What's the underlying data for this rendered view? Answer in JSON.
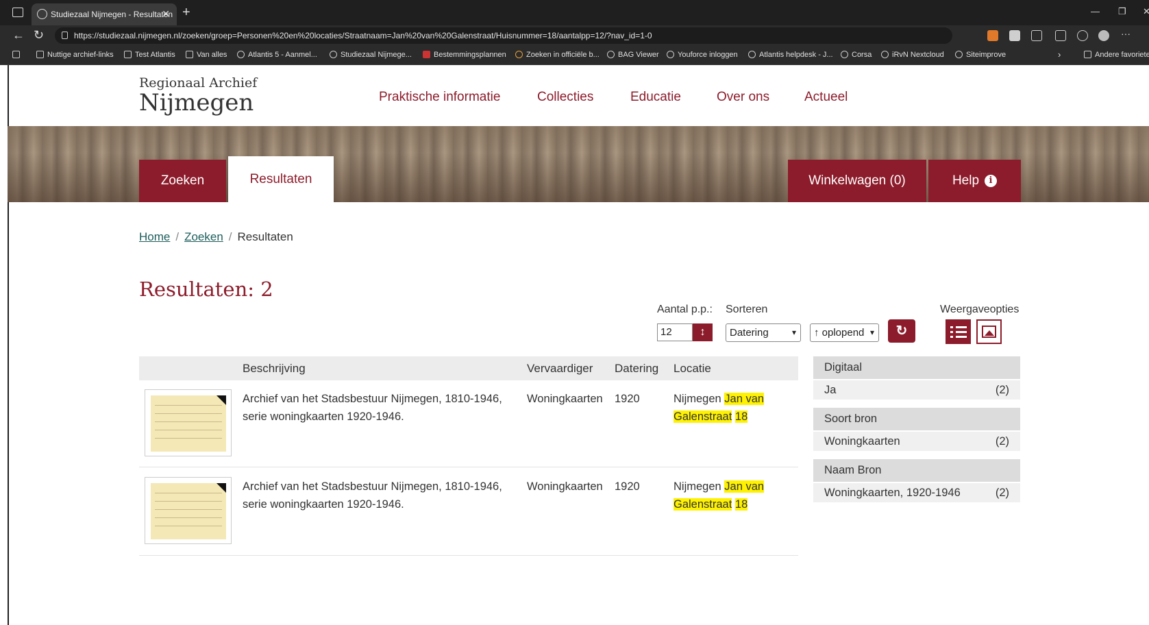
{
  "browser": {
    "tab_title": "Studiezaal Nijmegen - Resultaten",
    "url": "https://studiezaal.nijmegen.nl/zoeken/groep=Personen%20en%20locaties/Straatnaam=Jan%20van%20Galenstraat/Huisnummer=18/aantalpp=12/?nav_id=1-0",
    "bookmarks": [
      "Nuttige archief-links",
      "Test Atlantis",
      "Van alles",
      "Atlantis 5 - Aanmel...",
      "Studiezaal Nijmege...",
      "Bestemmingsplannen",
      "Zoeken in officiële b...",
      "BAG Viewer",
      "Youforce inloggen",
      "Atlantis helpdesk - J...",
      "Corsa",
      "iRvN Nextcloud",
      "Siteimprove"
    ],
    "other_favorites": "Andere favoriete"
  },
  "site": {
    "logo_small": "Regionaal Archief",
    "logo_big": "Nijmegen",
    "nav": [
      "Praktische informatie",
      "Collecties",
      "Educatie",
      "Over ons",
      "Actueel"
    ],
    "tab_zoeken": "Zoeken",
    "tab_resultaten": "Resultaten",
    "winkelwagen": "Winkelwagen (0)",
    "help": "Help",
    "help_icon": "i"
  },
  "breadcrumb": {
    "home": "Home",
    "zoeken": "Zoeken",
    "current": "Resultaten"
  },
  "results": {
    "title": "Resultaten: 2",
    "aantal_label": "Aantal p.p.:",
    "aantal_value": "12",
    "sorteren_label": "Sorteren",
    "sort_field": "Datering",
    "sort_order": "↑ oplopend",
    "weergave_label": "Weergaveopties"
  },
  "table": {
    "headers": [
      "Beschrijving",
      "Vervaardiger",
      "Datering",
      "Locatie"
    ],
    "rows": [
      {
        "desc1": "Archief van het Stadsbestuur Nijmegen, 1810-1946,",
        "desc2": "serie woningkaarten 1920-1946.",
        "maker": "Woningkaarten",
        "date": "1920",
        "loc_city": "Nijmegen",
        "loc_hl1": "Jan van",
        "loc_hl2": "Galenstraat",
        "loc_hl3": "18"
      },
      {
        "desc1": "Archief van het Stadsbestuur Nijmegen, 1810-1946,",
        "desc2": "serie woningkaarten 1920-1946.",
        "maker": "Woningkaarten",
        "date": "1920",
        "loc_city": "Nijmegen",
        "loc_hl1": "Jan van",
        "loc_hl2": "Galenstraat",
        "loc_hl3": "18"
      }
    ]
  },
  "facets": [
    {
      "heading": "Digitaal",
      "label": "Ja",
      "count": "(2)"
    },
    {
      "heading": "Soort bron",
      "label": "Woningkaarten",
      "count": "(2)"
    },
    {
      "heading": "Naam Bron",
      "label": "Woningkaarten, 1920-1946",
      "count": "(2)"
    }
  ],
  "colors": {
    "accent": "#8c1c2b",
    "link": "#1d5d5a",
    "highlight": "#fff200"
  }
}
